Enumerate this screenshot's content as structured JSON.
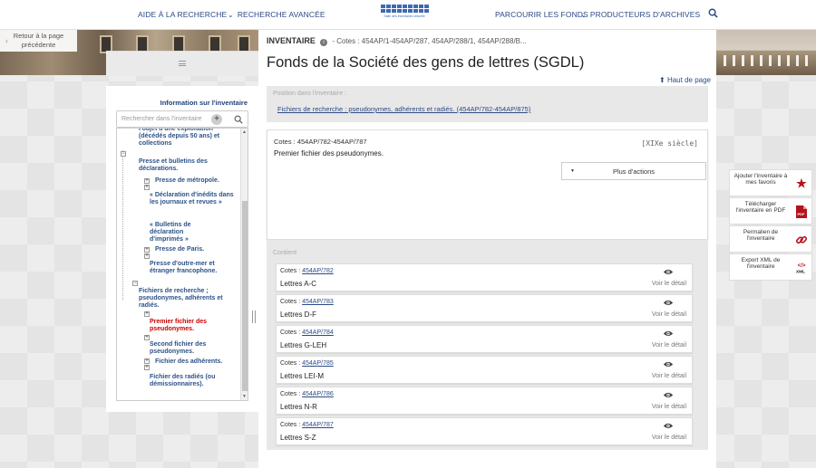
{
  "header": {
    "nav_left": [
      "AIDE À LA RECHERCHE",
      "RECHERCHE AVANCÉE"
    ],
    "nav_right": [
      "PARCOURIR LES FONDS",
      "PRODUCTEURS D'ARCHIVES"
    ],
    "logo_text": "Salle des inventaires virtuelle"
  },
  "back_link": {
    "line1": "Retour à la page",
    "line2": "précédente"
  },
  "inventory": {
    "label": "INVENTAIRE",
    "cotes_line": "- Cotes : 454AP/1-454AP/287, 454AP/288/1, 454AP/288/B...",
    "title": "Fonds de la Société des gens de lettres (SGDL)",
    "haut_de_page": "Haut de page",
    "position_label": "Position dans l'inventaire :",
    "position_link": "Fichiers de recherche : pseudonymes, adhérents et radiés. (454AP/782-454AP/875)"
  },
  "detail": {
    "cotes": "Cotes : 454AP/782-454AP/787",
    "siecle": "[XIXe siècle]",
    "description": "Premier fichier des pseudonymes.",
    "actions_label": "Plus d'actions"
  },
  "contient": {
    "label": "Contient",
    "cotes_prefix": "Cotes : ",
    "voir_label": "Voir le détail",
    "items": [
      {
        "cote": "454AP/782",
        "title": "Lettres A-C"
      },
      {
        "cote": "454AP/783",
        "title": "Lettres D-F"
      },
      {
        "cote": "454AP/784",
        "title": "Lettres G-LEH"
      },
      {
        "cote": "454AP/785",
        "title": "Lettres LEI-M"
      },
      {
        "cote": "454AP/786",
        "title": "Lettres N-R"
      },
      {
        "cote": "454AP/787",
        "title": "Lettres S-Z"
      }
    ]
  },
  "sidebar": {
    "title": "Information sur l'inventaire",
    "search_placeholder": "Rechercher dans l'inventaire",
    "tree": [
      "l'objet d'une exploitation (décédés depuis 50 ans) et collections",
      "Presse et bulletins des déclarations.",
      "Presse de métropole.",
      "« Déclaration d'inédits dans les journaux et revues »",
      "« Bulletins de déclaration d'imprimés »",
      "Presse de Paris.",
      "Presse d'outre-mer et étranger francophone.",
      "Fichiers de recherche ; pseudonymes, adhérents et radiés.",
      "Premier fichier des pseudonymes.",
      "Second fichier des pseudonymes.",
      "Fichier des adhérents.",
      "Fichier des radiés (ou démissionnaires)."
    ]
  },
  "right_actions": [
    {
      "label": "Ajouter l'inventaire à mes favoris",
      "icon": "star-icon"
    },
    {
      "label": "Télécharger l'inventaire en PDF",
      "icon": "pdf-icon"
    },
    {
      "label": "Permalien de l'inventaire",
      "icon": "link-icon"
    },
    {
      "label": "Export XML de l'inventaire",
      "icon": "xml-icon"
    }
  ],
  "colors": {
    "link": "#2c4a86",
    "active": "#cc0000",
    "accent": "#b5121b"
  }
}
